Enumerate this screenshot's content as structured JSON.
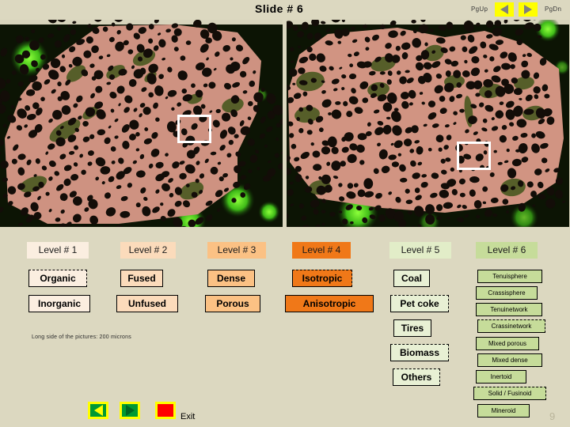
{
  "header": {
    "title": "Slide  # 6",
    "pgup_label": "PgUp",
    "pgdn_label": "PgDn",
    "pgup_icon": "triangle-left-icon",
    "pgdn_icon": "triangle-right-icon"
  },
  "images": [
    {
      "name": "char-micrograph-left",
      "roi_label": "region-of-interest-box"
    },
    {
      "name": "char-micrograph-right",
      "roi_label": "region-of-interest-box"
    }
  ],
  "caption": "Long side of the pictures: 200 microns",
  "levels": [
    {
      "header": "Level # 1",
      "header_bg": "#fbeee0",
      "node_bg": "#fbeee0",
      "items": [
        {
          "label": "Organic",
          "shadow": true
        },
        {
          "label": "Inorganic",
          "shadow": false
        }
      ]
    },
    {
      "header": "Level # 2",
      "header_bg": "#fbdbbb",
      "node_bg": "#fbdbbb",
      "items": [
        {
          "label": "Fused",
          "shadow": false
        },
        {
          "label": "Unfused",
          "shadow": false
        }
      ]
    },
    {
      "header": "Level # 3",
      "header_bg": "#fbc184",
      "node_bg": "#fbc184",
      "items": [
        {
          "label": "Dense",
          "shadow": false
        },
        {
          "label": "Porous",
          "shadow": false
        }
      ]
    },
    {
      "header": "Level # 4",
      "header_bg": "#f07818",
      "node_bg": "#f07818",
      "items": [
        {
          "label": "Isotropic",
          "shadow": true
        },
        {
          "label": "Anisotropic",
          "shadow": false
        }
      ]
    },
    {
      "header": "Level # 5",
      "header_bg": "#e2edc8",
      "node_bg": "#e8f0d4",
      "items": [
        {
          "label": "Coal",
          "shadow": false
        },
        {
          "label": "Pet coke",
          "shadow": true
        },
        {
          "label": "Tires",
          "shadow": false
        },
        {
          "label": "Biomass",
          "shadow": true
        },
        {
          "label": "Others",
          "shadow": true
        }
      ]
    },
    {
      "header": "Level # 6",
      "header_bg": "#c6dc9a",
      "node_bg": "#c6dc9a",
      "items": [
        {
          "label": "Tenuisphere",
          "shadow": false
        },
        {
          "label": "Crassisphere",
          "shadow": false
        },
        {
          "label": "Tenuinetwork",
          "shadow": false
        },
        {
          "label": "Crassinetwork",
          "shadow": true
        },
        {
          "label": "Mixed porous",
          "shadow": false
        },
        {
          "label": "Mixed dense",
          "shadow": false
        },
        {
          "label": "Inertoid",
          "shadow": false
        },
        {
          "label": "Solid / Fusinoid",
          "shadow": true
        },
        {
          "label": "Mineroid",
          "shadow": false
        }
      ]
    }
  ],
  "footer": {
    "back_icon": "triangle-left-icon",
    "forward_icon": "triangle-right-icon",
    "exit_icon": "stop-square-icon",
    "exit_label": "Exit",
    "page_number": "9"
  },
  "colors": {
    "background": "#dcd8c0",
    "accent_yellow": "#ffff00",
    "accent_green": "#009933",
    "accent_red": "#ff0000"
  }
}
